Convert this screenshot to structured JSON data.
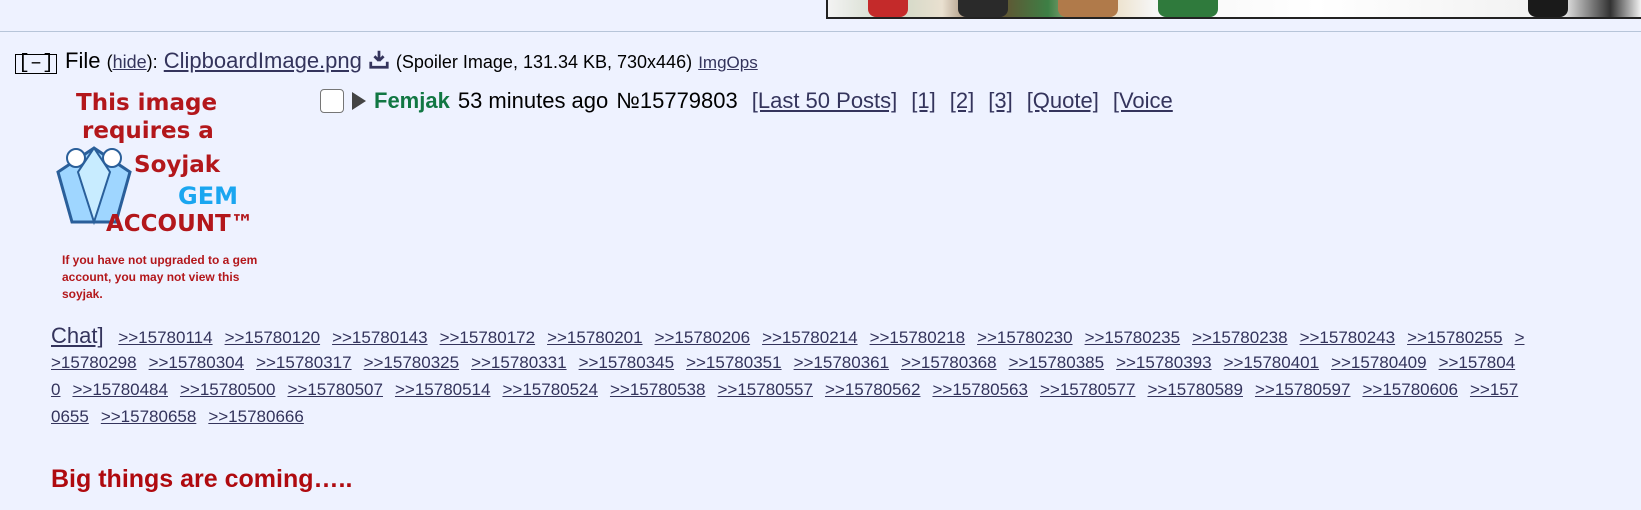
{
  "file": {
    "collapse_label": "[–]",
    "label": "File",
    "hide_open": "(",
    "hide_label": "hide",
    "hide_close": "):",
    "filename": "ClipboardImage.png",
    "meta": "(Spoiler Image, 131.34 KB, 730x446)",
    "imgops": "ImgOps"
  },
  "spoiler": {
    "line1": "This image",
    "line2": "requires a",
    "line3": "Soyjak",
    "line4": "GEM",
    "line5": "ACCOUNT™",
    "fine_print": "If you have not upgraded to a gem account, you may not view this soyjak."
  },
  "post": {
    "name": "Femjak",
    "time": "53 minutes ago",
    "number": "№15779803",
    "links": [
      "[Last 50 Posts]",
      "[1]",
      "[2]",
      "[3]",
      "[Quote]",
      "[Voice"
    ]
  },
  "backlinks": {
    "chat_label": "Chat]",
    "row1": [
      ">>15780114",
      ">>15780120",
      ">>15780143",
      ">>15780172",
      ">>15780201",
      ">>15780206",
      ">>15780214",
      ">>15780218",
      ">>15780230",
      ">>15780235",
      ">>15780238",
      ">>15780243",
      ">>15780255",
      ">"
    ],
    "row2": [
      ">15780298",
      ">>15780304",
      ">>15780317",
      ">>15780325",
      ">>15780331",
      ">>15780345",
      ">>15780351",
      ">>15780361",
      ">>15780368",
      ">>15780385",
      ">>15780393",
      ">>15780401",
      ">>15780409",
      ">>157804"
    ],
    "row3": [
      "0",
      ">>15780484",
      ">>15780500",
      ">>15780507",
      ">>15780514",
      ">>15780524",
      ">>15780538",
      ">>15780557",
      ">>15780562",
      ">>15780563",
      ">>15780577",
      ">>15780589",
      ">>15780597",
      ">>15780606",
      ">>157"
    ],
    "row4": [
      "0655",
      ">>15780658",
      ">>15780666"
    ]
  },
  "message": "Big things are coming….."
}
